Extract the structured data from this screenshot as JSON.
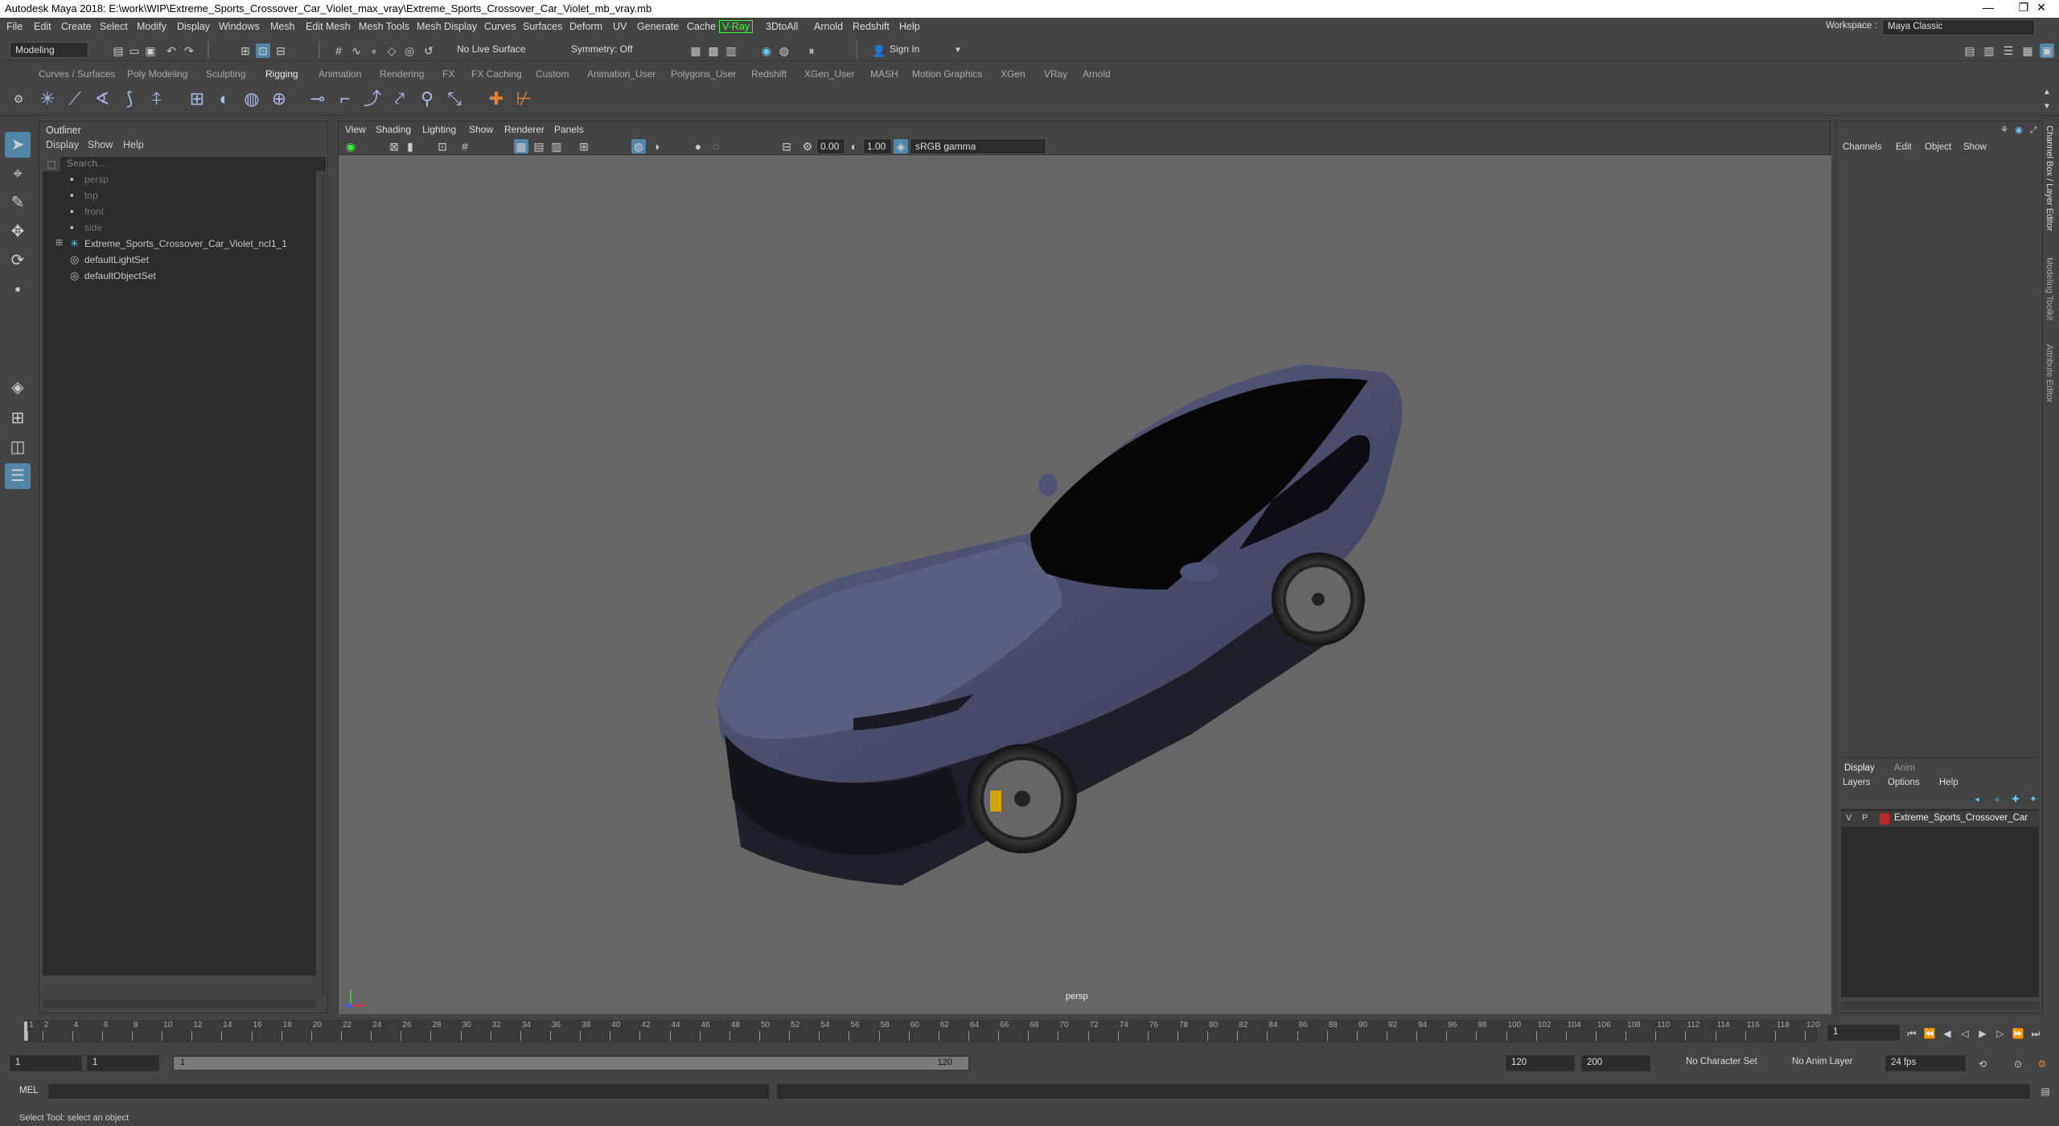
{
  "window": {
    "title": "Autodesk Maya 2018: E:\\work\\WIP\\Extreme_Sports_Crossover_Car_Violet_max_vray\\Extreme_Sports_Crossover_Car_Violet_mb_vray.mb",
    "minimize": "—",
    "restore": "❐",
    "close": "✕"
  },
  "menubar": {
    "items": [
      "File",
      "Edit",
      "Create",
      "Select",
      "Modify",
      "Display",
      "Windows",
      "Mesh",
      "Edit Mesh",
      "Mesh Tools",
      "Mesh Display",
      "Curves",
      "Surfaces",
      "Deform",
      "UV",
      "Generate",
      "Cache",
      "V-Ray",
      "3DtoAll",
      "Arnold",
      "Redshift",
      "Help"
    ],
    "workspace_label": "Workspace :",
    "workspace_value": "Maya Classic"
  },
  "statusline": {
    "mode": "Modeling",
    "live_surface": "No Live Surface",
    "symmetry": "Symmetry: Off",
    "sign_in": "Sign In"
  },
  "shelf": {
    "tabs": [
      "Curves / Surfaces",
      "Poly Modeling",
      "Sculpting",
      "Rigging",
      "Animation",
      "Rendering",
      "FX",
      "FX Caching",
      "Custom",
      "Animation_User",
      "Polygons_User",
      "Redshift",
      "XGen_User",
      "MASH",
      "Motion Graphics",
      "XGen",
      "VRay",
      "Arnold"
    ],
    "active_tab": "Rigging"
  },
  "outliner": {
    "title": "Outliner",
    "menu": [
      "Display",
      "Show",
      "Help"
    ],
    "search_placeholder": "Search...",
    "items": [
      {
        "label": "persp",
        "icon": "camera-icon",
        "dim": true
      },
      {
        "label": "top",
        "icon": "camera-icon",
        "dim": true
      },
      {
        "label": "front",
        "icon": "camera-icon",
        "dim": true
      },
      {
        "label": "side",
        "icon": "camera-icon",
        "dim": true
      },
      {
        "label": "Extreme_Sports_Crossover_Car_Violet_ncl1_1",
        "icon": "group-icon",
        "dim": false
      },
      {
        "label": "defaultLightSet",
        "icon": "set-icon",
        "dim": false
      },
      {
        "label": "defaultObjectSet",
        "icon": "set-icon",
        "dim": false
      }
    ]
  },
  "viewport": {
    "menu": [
      "View",
      "Shading",
      "Lighting",
      "Show",
      "Renderer",
      "Panels"
    ],
    "exposure": "0.00",
    "gamma": "1.00",
    "color_space": "sRGB gamma",
    "camera_label": "persp"
  },
  "channelbox": {
    "menu": [
      "Channels",
      "Edit",
      "Object",
      "Show"
    ],
    "layer_tabs": [
      "Display",
      "Anim"
    ],
    "layer_menu": [
      "Layers",
      "Options",
      "Help"
    ],
    "layer": {
      "v": "V",
      "p": "P",
      "name": "Extreme_Sports_Crossover_Car",
      "color": "#c0282d"
    }
  },
  "sidetabs": [
    "Channel Box / Layer Editor",
    "Modeling Toolkit",
    "Attribute Editor"
  ],
  "timeslider": {
    "ticks": [
      "1",
      "2",
      "4",
      "6",
      "8",
      "10",
      "12",
      "14",
      "16",
      "18",
      "20",
      "22",
      "24",
      "26",
      "28",
      "30",
      "32",
      "34",
      "36",
      "38",
      "40",
      "42",
      "44",
      "46",
      "48",
      "50",
      "52",
      "54",
      "56",
      "58",
      "60",
      "62",
      "64",
      "66",
      "68",
      "70",
      "72",
      "74",
      "76",
      "78",
      "80",
      "82",
      "84",
      "86",
      "88",
      "90",
      "92",
      "94",
      "96",
      "98",
      "100",
      "102",
      "104",
      "106",
      "108",
      "110",
      "112",
      "114",
      "116",
      "118",
      "120"
    ],
    "current_frame": "1"
  },
  "range": {
    "start": "1",
    "start2": "1",
    "range_start": "1",
    "range_end": "120",
    "end": "120",
    "end2": "200",
    "character_set": "No Character Set",
    "anim_layer": "No Anim Layer",
    "fps": "24 fps"
  },
  "cmdline": {
    "label": "MEL"
  },
  "helpline": {
    "text": "Select Tool: select an object"
  },
  "colors": {
    "accent": "#5285a6",
    "car_body": "#4a4e6e",
    "bg": "#444444",
    "viewport": "#666666"
  }
}
